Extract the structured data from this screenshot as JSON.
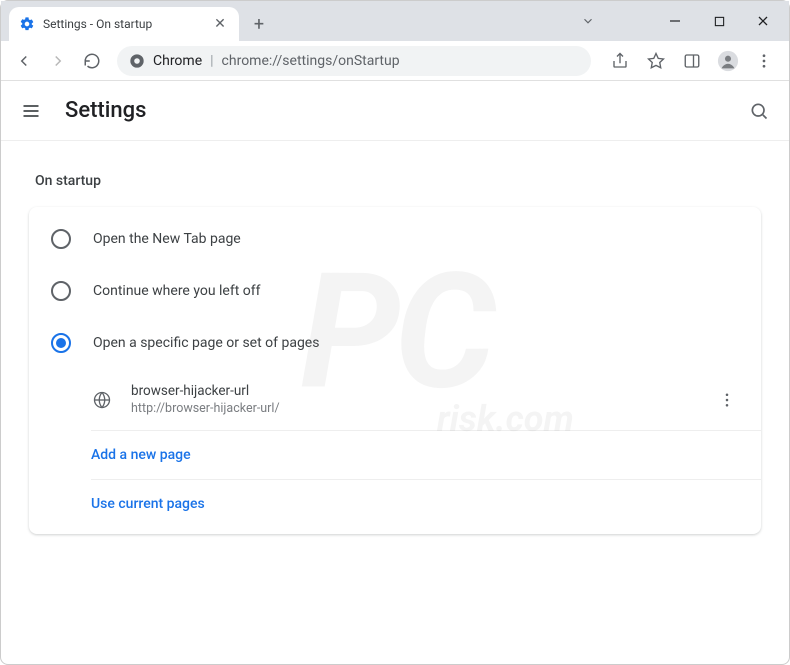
{
  "window": {
    "tab_title": "Settings - On startup"
  },
  "omnibox": {
    "scheme_label": "Chrome",
    "url_path": "chrome://settings/onStartup"
  },
  "header": {
    "title": "Settings"
  },
  "section": {
    "heading": "On startup",
    "options": [
      {
        "label": "Open the New Tab page",
        "selected": false
      },
      {
        "label": "Continue where you left off",
        "selected": false
      },
      {
        "label": "Open a specific page or set of pages",
        "selected": true
      }
    ],
    "page_entry": {
      "name": "browser-hijacker-url",
      "url": "http://browser-hijacker-url/"
    },
    "add_page_label": "Add a new page",
    "use_current_label": "Use current pages"
  },
  "watermark": {
    "big": "PC",
    "sub": "risk.com"
  }
}
